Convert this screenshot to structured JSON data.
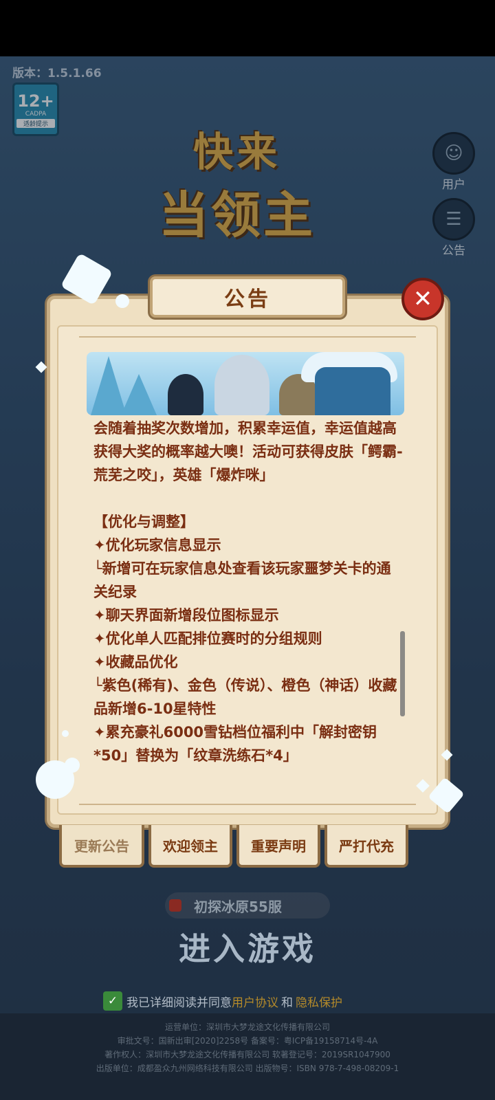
{
  "app": {
    "version": "版本：1.5.1.66",
    "age_rating": {
      "value": "12+",
      "org": "CADPA",
      "tip": "适龄提示"
    },
    "logo": {
      "line1": "快来",
      "line2": "当领主"
    }
  },
  "side_buttons": [
    {
      "label": "用户",
      "icon": "user-icon"
    },
    {
      "label": "公告",
      "icon": "notice-icon"
    }
  ],
  "dialog": {
    "title": "公告",
    "content": {
      "p1": "会随着抽奖次数增加，积累幸运值，幸运值越高获得大奖的概率越大噢！活动可获得皮肤「鳄霸-荒芜之咬」，英雄「爆炸咪」",
      "section": "【优化与调整】",
      "items": [
        "✦优化玩家信息显示",
        "└新增可在玩家信息处查看该玩家噩梦关卡的通关纪录",
        "✦聊天界面新增段位图标显示",
        "✦优化单人匹配排位赛时的分组规则",
        "✦收藏品优化",
        "└紫色(稀有)、金色（传说）、橙色（神话）收藏品新增6-10星特性",
        "✦累充豪礼6000雪钻档位福利中「解封密钥*50」替换为「纹章洗练石*4」"
      ]
    },
    "tabs": [
      "更新公告",
      "欢迎领主",
      "重要声明",
      "严打代充"
    ],
    "active_tab": 0
  },
  "server": {
    "name": "初探冰原55服"
  },
  "enter_button": "进入游戏",
  "agreement": {
    "prefix": "我已详细阅读并同意",
    "link1": "用户协议",
    "and": "和",
    "link2": "隐私保护"
  },
  "footer": [
    "运营单位：深圳市大梦龙途文化传播有限公司",
    "审批文号：国新出审[2020]2258号 备案号：粤ICP备19158714号-4A",
    "著作权人：深圳市大梦龙途文化传播有限公司 软著登记号：2019SR1047900",
    "出版单位：成都盈众九州网络科技有限公司 出版物号：ISBN 978-7-498-08209-1"
  ],
  "colors": {
    "accent": "#7a2e12",
    "close": "#c8352a",
    "link": "#b48a2a"
  }
}
